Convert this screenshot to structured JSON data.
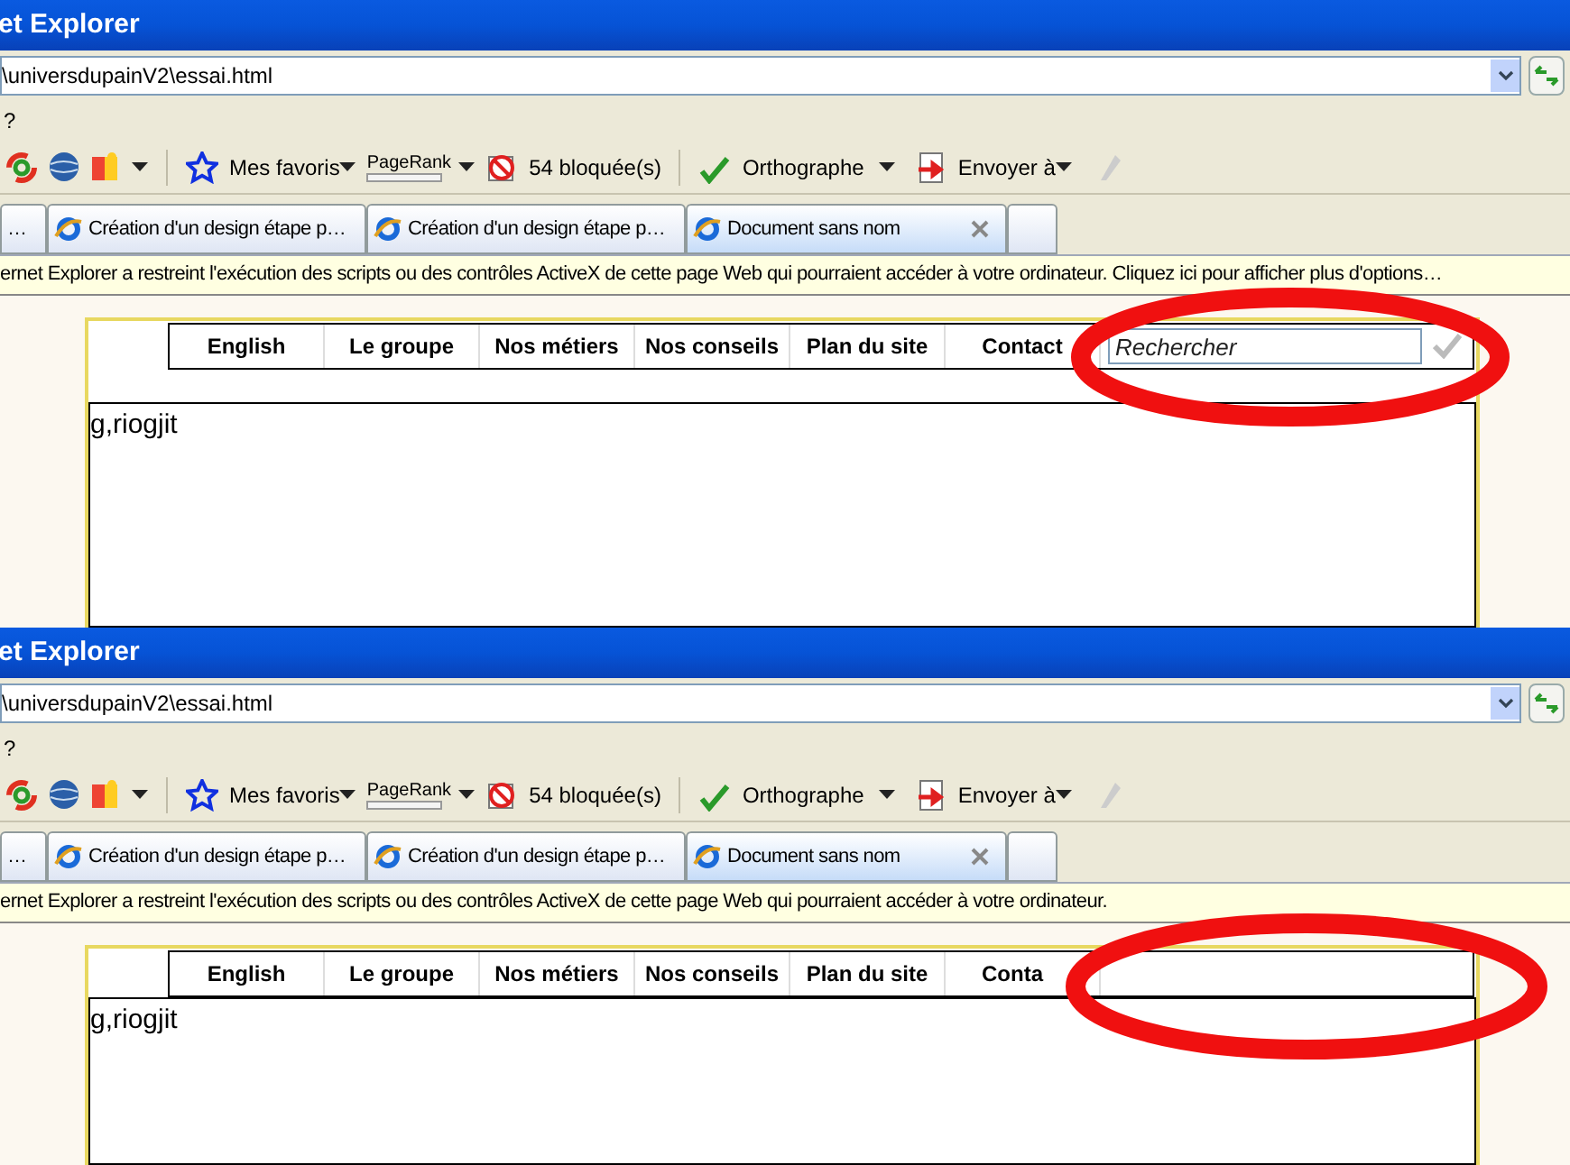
{
  "panels": [
    {
      "window": {
        "title": "et Explorer"
      },
      "address": "\\universdupainV2\\essai.html",
      "menu": "?",
      "toolbar": {
        "favorites": "Mes favoris",
        "pagerank": "PageRank",
        "blocked": "54 bloquée(s)",
        "spelling": "Orthographe",
        "send": "Envoyer à"
      },
      "tabs": [
        {
          "label": "…",
          "selected": false
        },
        {
          "label": "Création d'un design étape p…",
          "selected": false
        },
        {
          "label": "Création d'un design étape p…",
          "selected": false
        },
        {
          "label": "Document sans nom",
          "selected": true
        }
      ],
      "info_bar": "ernet Explorer a restreint l'exécution des scripts ou des contrôles ActiveX de cette page Web qui pourraient accéder à votre ordinateur. Cliquez ici pour afficher plus d'options…",
      "nav": [
        "English",
        "Le groupe",
        "Nos métiers",
        "Nos conseils",
        "Plan du site",
        "Contact"
      ],
      "search": {
        "placeholder": "Rechercher"
      },
      "content": "g,riogjit"
    },
    {
      "window": {
        "title": "et Explorer"
      },
      "address": "\\universdupainV2\\essai.html",
      "menu": "?",
      "toolbar": {
        "favorites": "Mes favoris",
        "pagerank": "PageRank",
        "blocked": "54 bloquée(s)",
        "spelling": "Orthographe",
        "send": "Envoyer à"
      },
      "tabs": [
        {
          "label": "…",
          "selected": false
        },
        {
          "label": "Création d'un design étape p…",
          "selected": false
        },
        {
          "label": "Création d'un design étape p…",
          "selected": false
        },
        {
          "label": "Document sans nom",
          "selected": true
        }
      ],
      "info_bar": "ernet Explorer a restreint l'exécution des scripts ou des contrôles ActiveX de cette page Web qui pourraient accéder à votre ordinateur.",
      "nav": [
        "English",
        "Le groupe",
        "Nos métiers",
        "Nos conseils",
        "Plan du site",
        "Conta"
      ],
      "content": "g,riogjit"
    }
  ]
}
